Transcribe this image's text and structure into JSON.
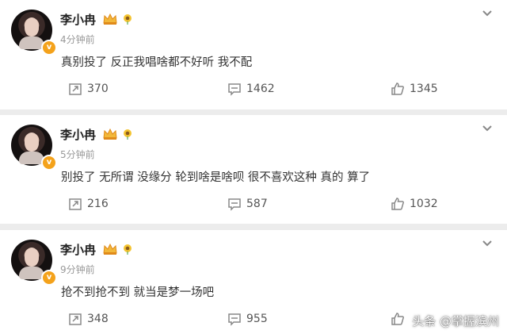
{
  "posts": [
    {
      "user": "李小冉",
      "time": "4分钟前",
      "text": "真别投了 反正我唱啥都不好听 我不配",
      "repost": "370",
      "comment": "1462",
      "like": "1345"
    },
    {
      "user": "李小冉",
      "time": "5分钟前",
      "text": "别投了 无所谓 没缘分 轮到啥是啥呗 很不喜欢这种 真的  算了",
      "repost": "216",
      "comment": "587",
      "like": "1032"
    },
    {
      "user": "李小冉",
      "time": "9分钟前",
      "text": "抢不到抢不到 就当是梦一场吧",
      "repost": "348",
      "comment": "955",
      "like": ""
    }
  ],
  "verified_badge": "v",
  "watermark": "头条 @掌握滨州",
  "colors": {
    "accent_badge": "#f4a21b",
    "background": "#ececec",
    "time_text": "#999999"
  },
  "icons": [
    "crown-badge-icon",
    "sunflower-badge-icon",
    "chevron-down-icon",
    "repost-icon",
    "comment-icon",
    "like-icon"
  ]
}
